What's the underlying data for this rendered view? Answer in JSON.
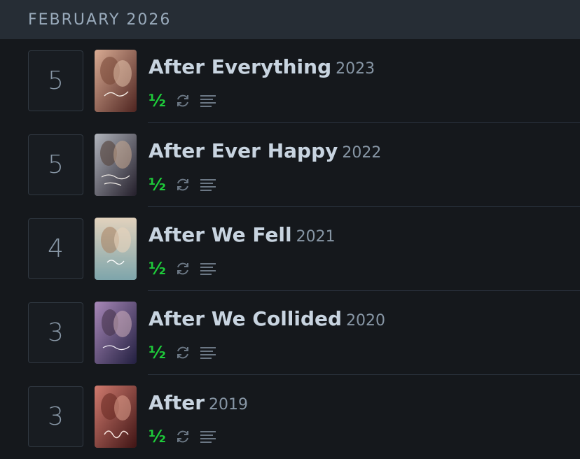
{
  "diary": {
    "month_label": "FEBRUARY 2026",
    "entries": [
      {
        "day": "5",
        "title": "After Everything",
        "year": "2023",
        "rating": "½",
        "poster_colors": [
          "#c89a86",
          "#5a2a25"
        ]
      },
      {
        "day": "5",
        "title": "After Ever Happy",
        "year": "2022",
        "rating": "½",
        "poster_colors": [
          "#a0a0a8",
          "#2a2530"
        ]
      },
      {
        "day": "4",
        "title": "After We Fell",
        "year": "2021",
        "rating": "½",
        "poster_colors": [
          "#d8c9b5",
          "#7fa3a8"
        ]
      },
      {
        "day": "3",
        "title": "After We Collided",
        "year": "2020",
        "rating": "½",
        "poster_colors": [
          "#9a7aa8",
          "#2a2545"
        ]
      },
      {
        "day": "3",
        "title": "After",
        "year": "2019",
        "rating": "½",
        "poster_colors": [
          "#c5706a",
          "#4a1a1a"
        ]
      }
    ]
  },
  "icons": {
    "rewatch": "rewatch-icon",
    "review": "review-icon"
  },
  "colors": {
    "header_bg": "#262d35",
    "page_bg": "#15181c",
    "rating_green": "#1ecb3a",
    "title_text": "#c8d4e0",
    "muted_text": "#8796a5"
  }
}
